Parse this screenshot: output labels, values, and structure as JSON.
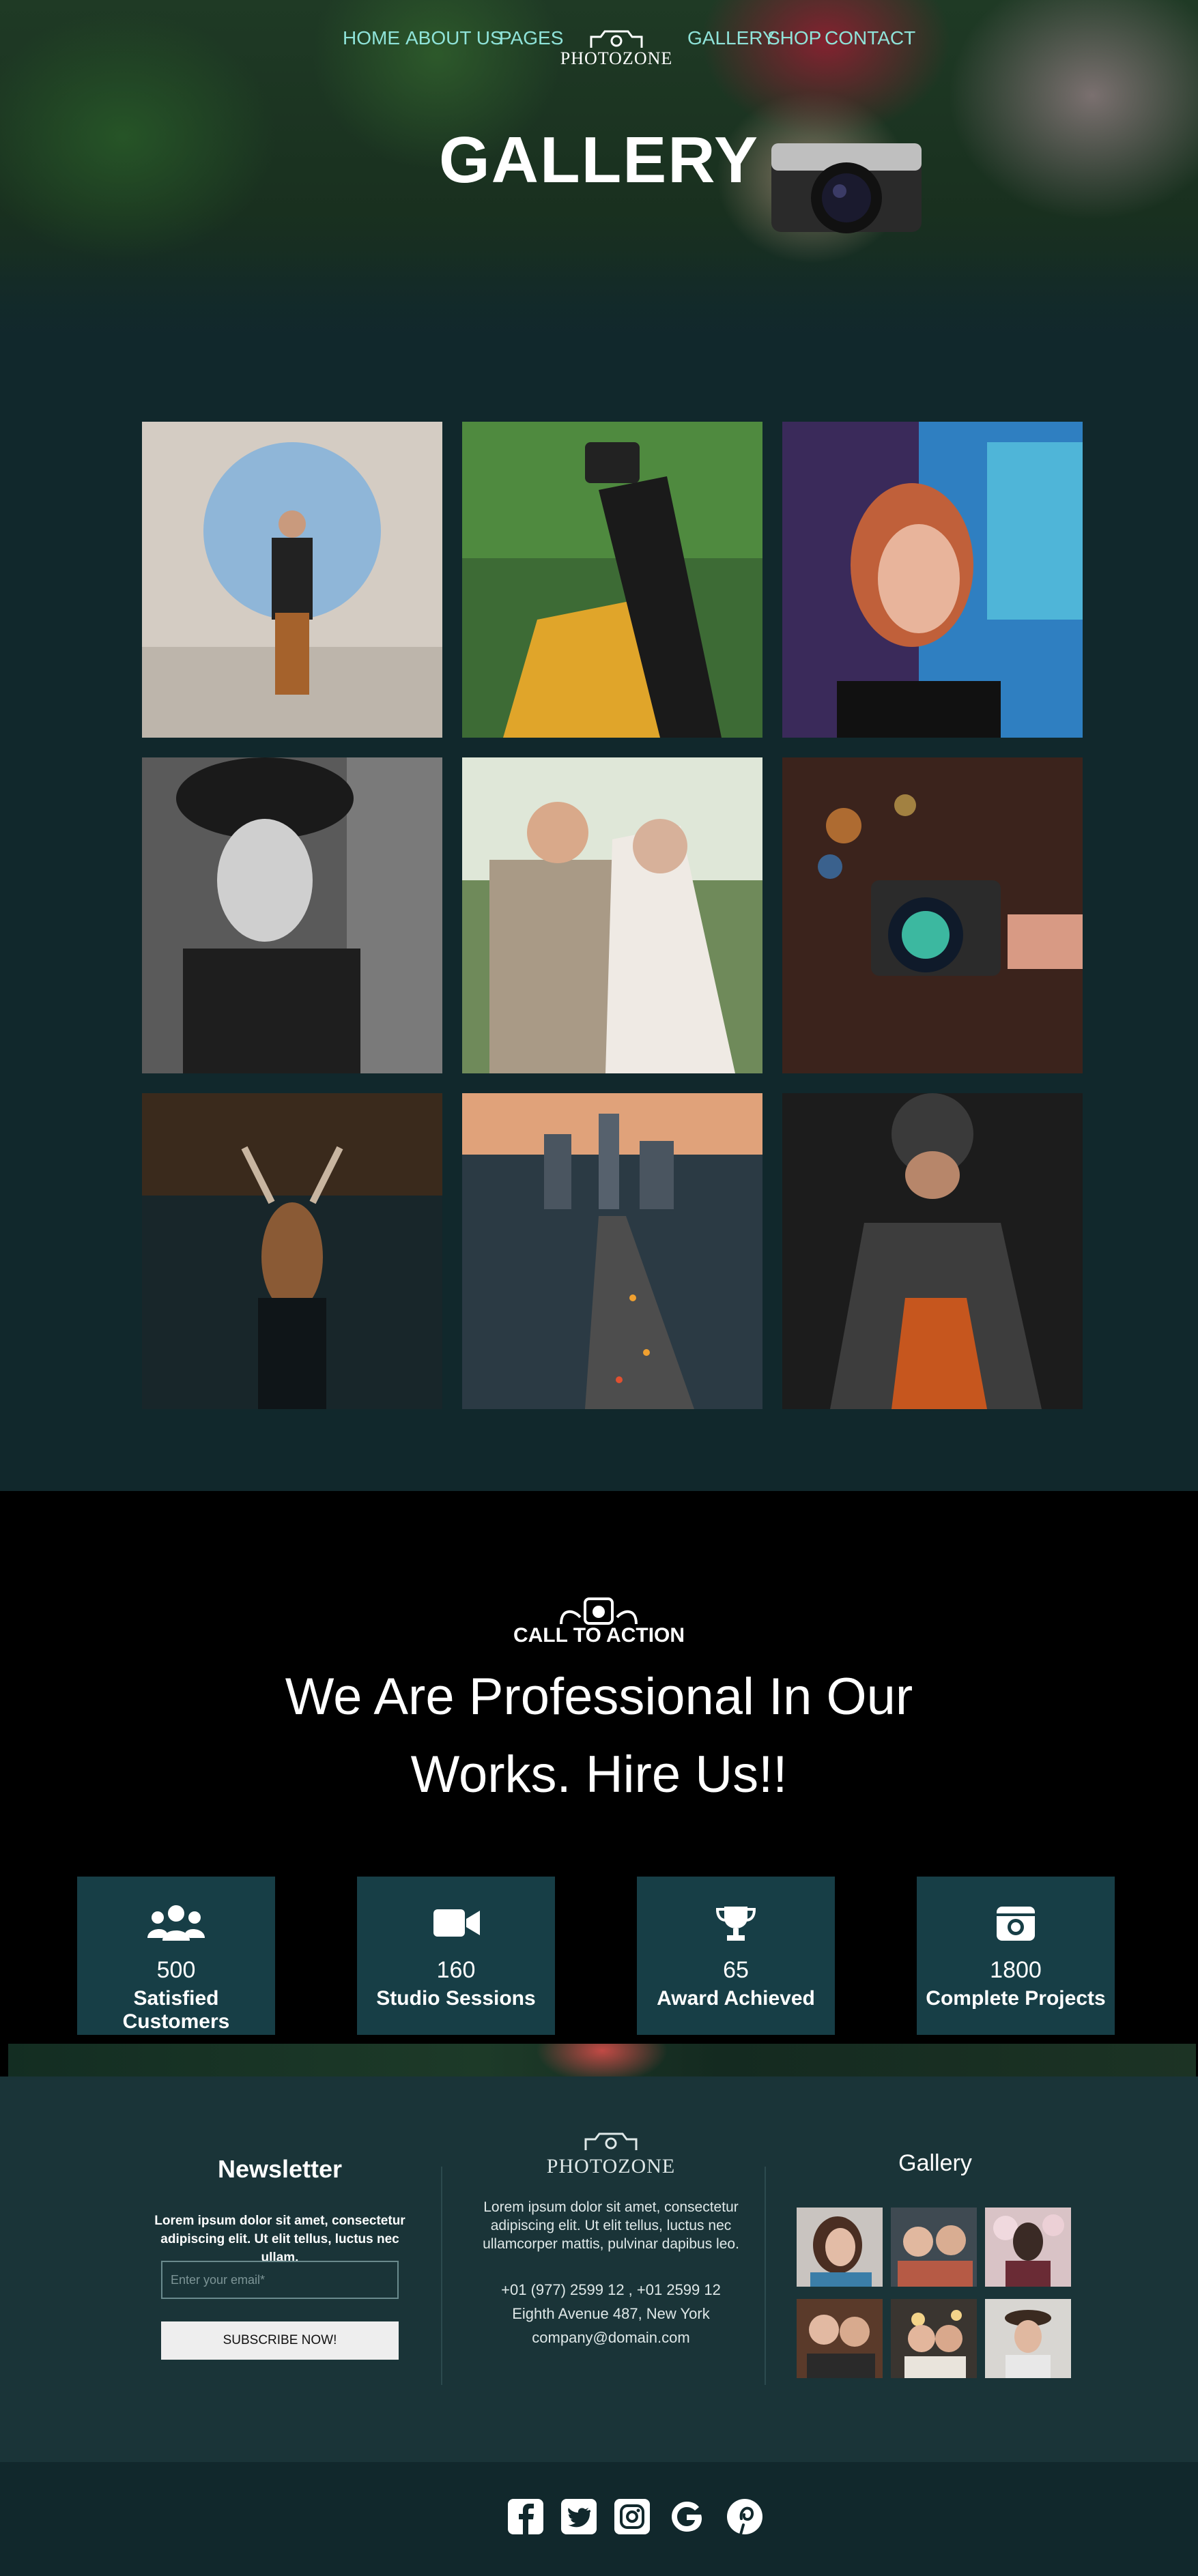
{
  "nav": {
    "left": [
      "HOME",
      "ABOUT US",
      "PAGES"
    ],
    "right": [
      "GALLERY",
      "SHOP",
      "CONTACT"
    ],
    "logo_text": "PHOTOZONE",
    "logo_icon": "camera-icon"
  },
  "hero": {
    "title": "GALLERY"
  },
  "gallery": {
    "photos": [
      "man-in-circle-photo",
      "woman-with-camera-photo",
      "smiling-woman-neon-photo",
      "woman-in-hat-photo",
      "wedding-couple-photo",
      "camera-bokeh-photo",
      "deer-photo",
      "city-road-photo",
      "man-in-jacket-photo"
    ]
  },
  "cta": {
    "small": "CALL TO ACTION",
    "line1": "We Are Professional In Our",
    "line2": "Works. Hire Us!!",
    "stats": [
      {
        "icon": "users-icon",
        "number": "500",
        "label": "Satisfied Customers"
      },
      {
        "icon": "video-icon",
        "number": "160",
        "label": "Studio Sessions"
      },
      {
        "icon": "trophy-icon",
        "number": "65",
        "label": "Award Achieved"
      },
      {
        "icon": "camera-icon",
        "number": "1800",
        "label": "Complete Projects"
      }
    ]
  },
  "footer": {
    "newsletter": {
      "title": "Newsletter",
      "text": "Lorem ipsum dolor sit amet, consectetur adipiscing elit. Ut elit tellus, luctus nec ullam.",
      "email_placeholder": "Enter your email*",
      "button": "SUBSCRIBE NOW!"
    },
    "about": {
      "logo_text": "PHOTOZONE",
      "text": "Lorem ipsum dolor sit amet, consectetur adipiscing elit. Ut elit tellus, luctus nec ullamcorper mattis, pulvinar dapibus leo.",
      "phone": "+01 (977) 2599 12 , +01 2599 12",
      "address": "Eighth Avenue 487, New York",
      "email": "company@domain.com"
    },
    "gallery_title": "Gallery"
  },
  "social": [
    "facebook-icon",
    "twitter-icon",
    "instagram-icon",
    "google-icon",
    "pinterest-icon"
  ],
  "colors": {
    "accent": "#8fe3d9",
    "dark_teal": "#11282c",
    "stat_box": "#173e46",
    "footer": "#1a3438"
  }
}
